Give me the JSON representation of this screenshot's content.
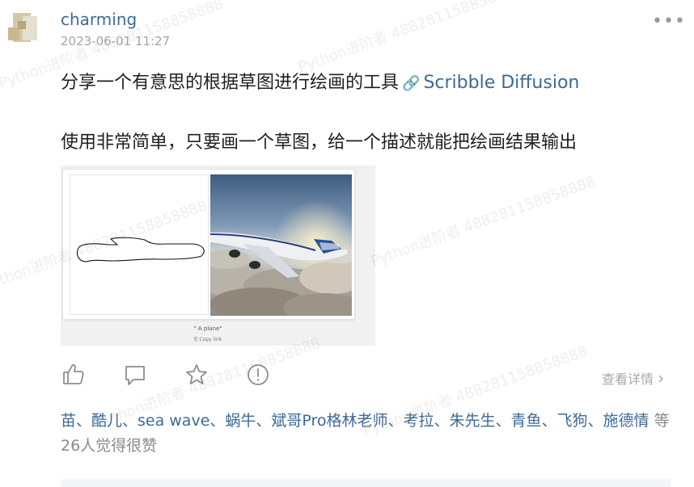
{
  "post": {
    "author": "charming",
    "timestamp": "2023-06-01 11:27",
    "more_icon": "more-dots-icon",
    "text_line1_prefix": "分享一个有意思的根据草图进行绘画的工具",
    "link_icon": "🔗",
    "link_text": "Scribble Diffusion",
    "text_line2": "使用非常简单，只要画一个草图，给一个描述就能把绘画结果输出"
  },
  "figure": {
    "caption": "\" A plane\"",
    "copy_link": "⎘ Copy link"
  },
  "actions": {
    "like_icon": "thumbs-up-icon",
    "comment_icon": "comment-icon",
    "favorite_icon": "star-icon",
    "report_icon": "alert-icon",
    "detail_label": "查看详情",
    "detail_chevron": "›"
  },
  "likes": {
    "names": "苗、酷儿、sea wave、蜗牛、斌哥Pro格林老师、考拉、朱先生、青鱼、飞狗、施德情",
    "suffix": " 等26人觉得很赞"
  },
  "watermark": {
    "text": "Python进阶者 488281158858888"
  },
  "colors": {
    "link": "#3d6a96",
    "muted": "#a4a4a4",
    "text": "#1f1f1f"
  }
}
